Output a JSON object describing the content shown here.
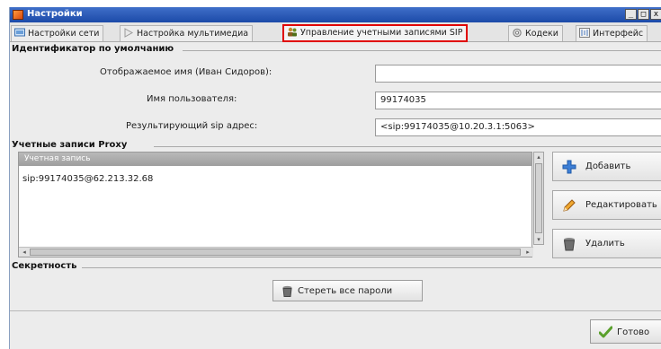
{
  "window": {
    "title": "Настройки",
    "buttons": {
      "minimize": "_",
      "maximize": "□",
      "close": "x"
    }
  },
  "tabs": [
    {
      "label": "Настройки сети",
      "icon": "network-icon",
      "active": false
    },
    {
      "label": "Настройка мультимедиа",
      "icon": "multimedia-icon",
      "active": false
    },
    {
      "label": "Управление учетными записями SIP",
      "icon": "users-icon",
      "active": true
    },
    {
      "label": "Кодеки",
      "icon": "codecs-icon",
      "active": false
    },
    {
      "label": "Интерфейс",
      "icon": "interface-icon",
      "active": false
    }
  ],
  "default_identity": {
    "section_title": "Идентификатор по умолчанию",
    "display_name_label": "Отображаемое имя (Иван Сидоров):",
    "display_name_value": "",
    "username_label": "Имя пользователя:",
    "username_value": "99174035",
    "sip_address_label": "Результирующий sip адрес:",
    "sip_address_value": "<sip:99174035@10.20.3.1:5063>"
  },
  "proxy": {
    "section_title": "Учетные записи Proxy",
    "column_header": "Учетная запись",
    "rows": [
      "sip:99174035@62.213.32.68"
    ],
    "buttons": {
      "add": "Добавить",
      "edit": "Редактировать",
      "delete": "Удалить"
    }
  },
  "privacy": {
    "section_title": "Секретность",
    "clear_passwords_label": "Стереть все пароли"
  },
  "footer": {
    "done_label": "Готово"
  },
  "colors": {
    "titlebar": "#1c4aa8",
    "active_tab_border": "#e00000",
    "list_header": "#a6a6a6"
  }
}
